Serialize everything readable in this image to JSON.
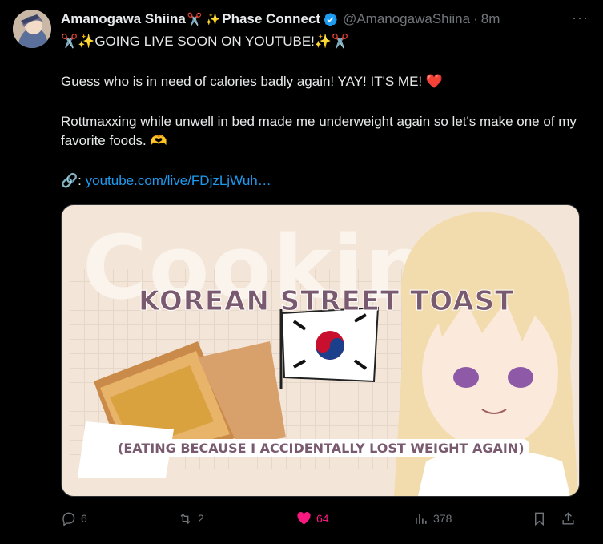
{
  "author": {
    "name": "Amanogawa Shiina",
    "name_suffix": "Phase Connect",
    "handle": "@AmanogawaShiina",
    "time": "8m"
  },
  "tweet": {
    "line1": "✂️✨GOING LIVE SOON ON YOUTUBE!✨✂️",
    "line2": "Guess who is in need of calories badly again! YAY! IT'S ME! ❤️",
    "line3": "Rottmaxxing while unwell in bed made me underweight again so let's make one of my favorite foods. 🫶",
    "link_prefix": "🔗: ",
    "link_text": "youtube.com/live/FDjzLjWuh…"
  },
  "media": {
    "big_title": "Cookin",
    "subtitle": "KOREAN STREET TOAST",
    "caption": "(EATING BECAUSE I ACCIDENTALLY LOST WEIGHT AGAIN)"
  },
  "actions": {
    "replies": "6",
    "reposts": "2",
    "likes": "64",
    "views": "378"
  },
  "icons": [
    "reply-icon",
    "repost-icon",
    "like-icon",
    "views-icon",
    "bookmark-icon",
    "share-icon",
    "more-icon",
    "verified-icon"
  ],
  "colors": {
    "like": "#f91880",
    "link": "#1d9bf0",
    "verified": "#1d9bf0",
    "muted": "#71767b"
  }
}
